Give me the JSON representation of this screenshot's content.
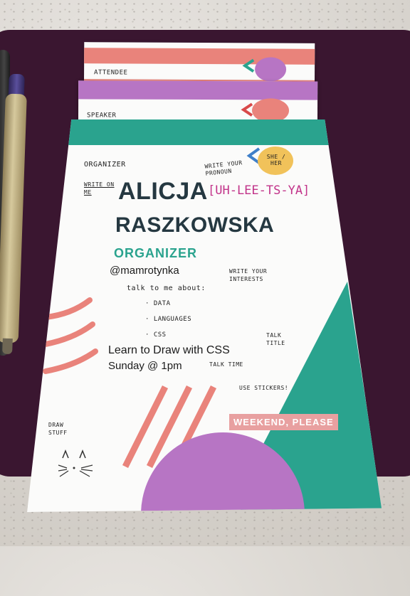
{
  "cards": {
    "attendee": {
      "label": "ATTENDEE",
      "stripe_color": "#e9837b",
      "circle_color": "#b775c4"
    },
    "speaker": {
      "label": "SPEAKER",
      "stripe_color": "#b775c4",
      "circle_color": "#e9837b"
    },
    "organizer": {
      "corner_label": "ORGANIZER",
      "stripe_color": "#2aa38e",
      "pronoun_circle_color": "#f1c25a",
      "pronouns": "SHE / HER",
      "hint_pronoun": "WRITE YOUR PRONOUN",
      "hint_write_on_me": "WRITE ON ME",
      "first_name": "ALICJA",
      "last_name": "RASZKOWSKA",
      "pronunciation": "[UH-LEE-TS-YA]",
      "role": "ORGANIZER",
      "handle": "@mamrotynka",
      "hint_interests": "WRITE YOUR INTERESTS",
      "talk_prompt": "talk to me about:",
      "interests": [
        "DATA",
        "LANGUAGES",
        "CSS"
      ],
      "talk_title": "Learn to Draw with CSS",
      "hint_talk_title": "TALK TITLE",
      "talk_time": "Sunday @ 1pm",
      "hint_talk_time": "TALK TIME",
      "hint_stickers": "USE STICKERS!",
      "badge": "WEEKEND, PLEASE",
      "hint_draw": "DRAW STUFF",
      "accent_coral": "#e9837b",
      "accent_purple": "#b775c4",
      "accent_teal": "#2aa38e"
    }
  }
}
